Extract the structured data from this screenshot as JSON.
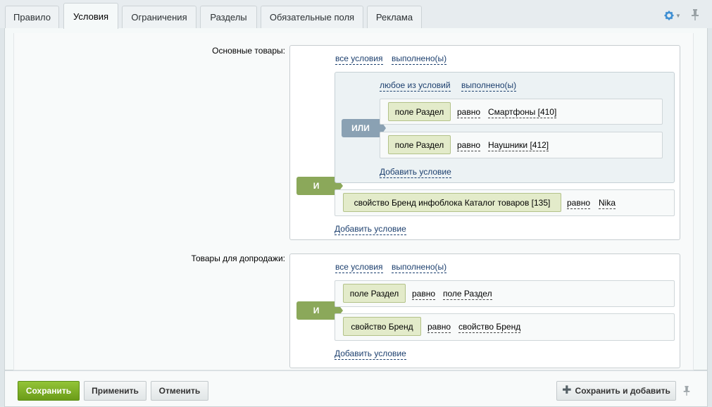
{
  "tabs": [
    {
      "label": "Правило"
    },
    {
      "label": "Условия"
    },
    {
      "label": "Ограничения"
    },
    {
      "label": "Разделы"
    },
    {
      "label": "Обязательные поля"
    },
    {
      "label": "Реклама"
    }
  ],
  "basic": {
    "label": "Основные товары:",
    "all_conditions": "все условия",
    "fulfilled": "выполнено(ы)",
    "and": "И",
    "or_group": {
      "any": "любое из условий",
      "fulfilled": "выполнено(ы)",
      "or": "ИЛИ",
      "rows": [
        {
          "field": "поле Раздел",
          "op": "равно",
          "value": "Смартфоны [410]"
        },
        {
          "field": "поле Раздел",
          "op": "равно",
          "value": "Наушники [412]"
        }
      ],
      "add": "Добавить условие"
    },
    "prop_row": {
      "field": "свойство Бренд инфоблока Каталог товаров [135]",
      "op": "равно",
      "value": "Nika"
    },
    "add": "Добавить условие"
  },
  "upsell": {
    "label": "Товары для допродажи:",
    "all_conditions": "все условия",
    "fulfilled": "выполнено(ы)",
    "and": "И",
    "rows": [
      {
        "field": "поле Раздел",
        "op": "равно",
        "value": "поле Раздел"
      },
      {
        "field": "свойство Бренд",
        "op": "равно",
        "value": "свойство Бренд"
      }
    ],
    "add": "Добавить условие"
  },
  "footer": {
    "save": "Сохранить",
    "apply": "Применить",
    "cancel": "Отменить",
    "save_add": "Сохранить и добавить"
  },
  "colors": {
    "accent_green": "#6b9c19",
    "and_tag": "#8ba85a",
    "or_tag": "#8aa1b3",
    "link": "#1c3f6e"
  },
  "icons": {
    "settings": "gear-icon",
    "pin": "pin-icon",
    "add": "plus-icon"
  }
}
